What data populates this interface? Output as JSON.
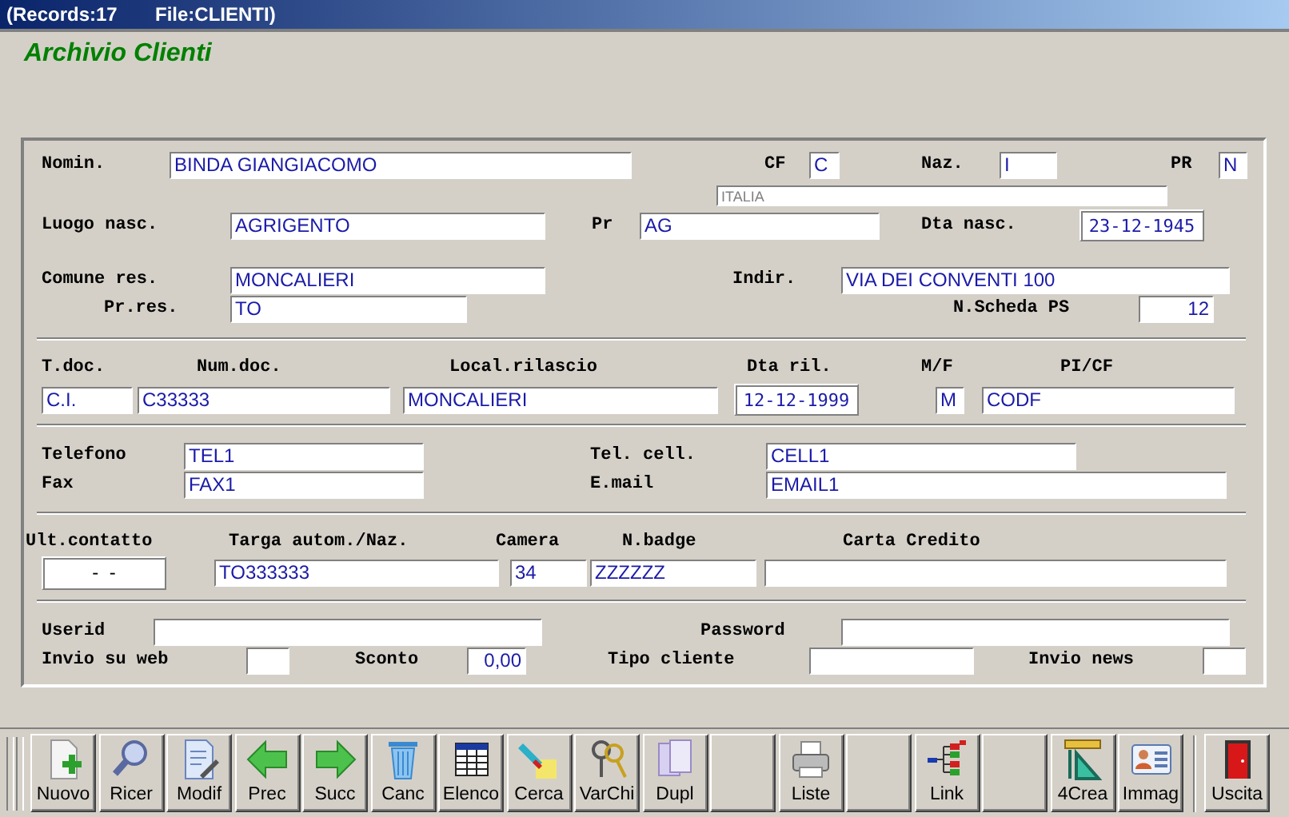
{
  "title_bar": {
    "records": "(Records:17",
    "file": "File:CLIENTI)"
  },
  "heading": "Archivio Clienti",
  "sections": [
    {
      "rows": [
        {
          "items": [
            {
              "kind": "label",
              "text": "Nomin."
            },
            {
              "kind": "field",
              "value": "BINDA GIANGIACOMO"
            },
            {
              "kind": "label",
              "text": "CF"
            },
            {
              "kind": "field",
              "value": "C"
            },
            {
              "kind": "label",
              "text": "Naz."
            },
            {
              "kind": "field",
              "value": "I"
            },
            {
              "kind": "label",
              "text": "PR"
            },
            {
              "kind": "field",
              "value": "N"
            }
          ]
        },
        {
          "items": [
            {
              "kind": "readonly",
              "value": "ITALIA"
            }
          ]
        },
        {
          "items": [
            {
              "kind": "label",
              "text": "Luogo nasc."
            },
            {
              "kind": "field",
              "value": "AGRIGENTO"
            },
            {
              "kind": "label",
              "text": "Pr"
            },
            {
              "kind": "field",
              "value": "AG"
            },
            {
              "kind": "label",
              "text": "Dta nasc."
            },
            {
              "kind": "date",
              "value": "23-12-1945"
            }
          ]
        },
        {
          "items": [
            {
              "kind": "label",
              "text": "Comune res."
            },
            {
              "kind": "field",
              "value": "MONCALIERI"
            },
            {
              "kind": "label",
              "text": "Indir."
            },
            {
              "kind": "field",
              "value": "VIA DEI CONVENTI 100"
            }
          ]
        },
        {
          "items": [
            {
              "kind": "label",
              "text": "Pr.res."
            },
            {
              "kind": "field",
              "value": "TO"
            },
            {
              "kind": "label",
              "text": "N.Scheda PS"
            },
            {
              "kind": "number",
              "value": "12"
            }
          ]
        }
      ]
    },
    {
      "rows": [
        {
          "items": [
            {
              "kind": "label",
              "text": "T.doc."
            },
            {
              "kind": "label",
              "text": "Num.doc."
            },
            {
              "kind": "label",
              "text": "Local.rilascio"
            },
            {
              "kind": "label",
              "text": "Dta ril."
            },
            {
              "kind": "label",
              "text": "M/F"
            },
            {
              "kind": "label",
              "text": "PI/CF"
            }
          ]
        },
        {
          "items": [
            {
              "kind": "field",
              "value": "C.I."
            },
            {
              "kind": "field",
              "value": "C33333"
            },
            {
              "kind": "field",
              "value": "MONCALIERI"
            },
            {
              "kind": "date",
              "value": "12-12-1999"
            },
            {
              "kind": "field",
              "value": "M"
            },
            {
              "kind": "field",
              "value": "CODF"
            }
          ]
        }
      ]
    },
    {
      "rows": [
        {
          "items": [
            {
              "kind": "label",
              "text": "Telefono"
            },
            {
              "kind": "field",
              "value": "TEL1"
            },
            {
              "kind": "label",
              "text": "Tel. cell."
            },
            {
              "kind": "field",
              "value": "CELL1"
            }
          ]
        },
        {
          "items": [
            {
              "kind": "label",
              "text": "Fax"
            },
            {
              "kind": "field",
              "value": "FAX1"
            },
            {
              "kind": "label",
              "text": "E.mail"
            },
            {
              "kind": "field",
              "value": "EMAIL1"
            }
          ]
        }
      ]
    },
    {
      "rows": [
        {
          "items": [
            {
              "kind": "label",
              "text": "Ult.contatto"
            },
            {
              "kind": "label",
              "text": "Targa autom./Naz."
            },
            {
              "kind": "label",
              "text": "Camera"
            },
            {
              "kind": "label",
              "text": "N.badge"
            },
            {
              "kind": "label",
              "text": "Carta Credito"
            }
          ]
        },
        {
          "items": [
            {
              "kind": "mask",
              "value": "-  -"
            },
            {
              "kind": "field",
              "value": "TO333333"
            },
            {
              "kind": "field",
              "value": "34"
            },
            {
              "kind": "field",
              "value": "ZZZZZZ"
            },
            {
              "kind": "field"
            }
          ]
        }
      ]
    },
    {
      "rows": [
        {
          "items": [
            {
              "kind": "label",
              "text": "Userid"
            },
            {
              "kind": "field"
            },
            {
              "kind": "label",
              "text": "Password"
            },
            {
              "kind": "field"
            }
          ]
        },
        {
          "items": [
            {
              "kind": "label",
              "text": "Invio su web"
            },
            {
              "kind": "field"
            },
            {
              "kind": "label",
              "text": "Sconto"
            },
            {
              "kind": "number",
              "value": "0,00"
            },
            {
              "kind": "label",
              "text": "Tipo cliente"
            },
            {
              "kind": "field"
            },
            {
              "kind": "label",
              "text": "Invio news"
            },
            {
              "kind": "field"
            }
          ]
        }
      ]
    }
  ],
  "toolbar": [
    {
      "kind": "button",
      "label": "Nuovo"
    },
    {
      "kind": "button",
      "label": "Ricer"
    },
    {
      "kind": "button",
      "label": "Modif"
    },
    {
      "kind": "button",
      "label": "Prec"
    },
    {
      "kind": "button",
      "label": "Succ"
    },
    {
      "kind": "button",
      "label": "Canc"
    },
    {
      "kind": "button",
      "label": "Elenco"
    },
    {
      "kind": "button",
      "label": "Cerca"
    },
    {
      "kind": "button",
      "label": "VarChi"
    },
    {
      "kind": "button",
      "label": "Dupl"
    },
    {
      "kind": "blank"
    },
    {
      "kind": "button",
      "label": "Liste"
    },
    {
      "kind": "blank"
    },
    {
      "kind": "button",
      "label": "Link"
    },
    {
      "kind": "blank"
    },
    {
      "kind": "button",
      "label": "4Crea"
    },
    {
      "kind": "button",
      "label": "Immag"
    },
    {
      "kind": "button",
      "label": "Uscita"
    }
  ]
}
